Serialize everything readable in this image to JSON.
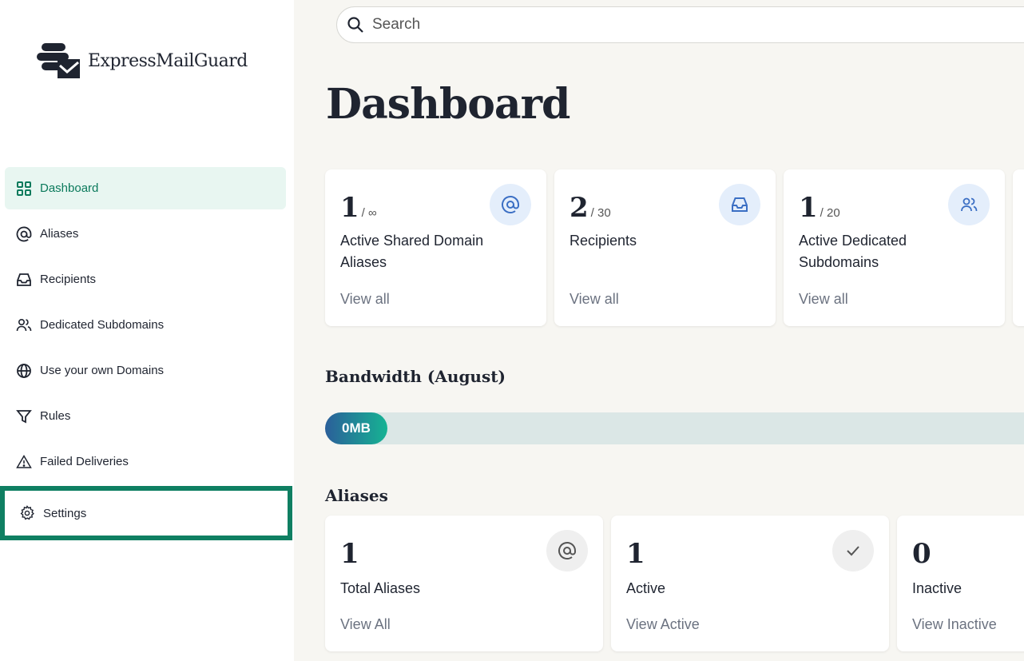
{
  "brand": {
    "name": "ExpressMailGuard"
  },
  "sidebar": {
    "items": [
      {
        "label": "Dashboard",
        "icon": "grid-icon"
      },
      {
        "label": "Aliases",
        "icon": "at-icon"
      },
      {
        "label": "Recipients",
        "icon": "inbox-icon"
      },
      {
        "label": "Dedicated Subdomains",
        "icon": "users-icon"
      },
      {
        "label": "Use your own Domains",
        "icon": "globe-icon"
      },
      {
        "label": "Rules",
        "icon": "filter-icon"
      },
      {
        "label": "Failed Deliveries",
        "icon": "warning-icon"
      },
      {
        "label": "Settings",
        "icon": "gear-icon"
      }
    ]
  },
  "search": {
    "placeholder": "Search"
  },
  "page": {
    "title": "Dashboard"
  },
  "stats": [
    {
      "value": "1",
      "max": "/ ∞",
      "label": "Active Shared Domain Aliases",
      "link": "View all"
    },
    {
      "value": "2",
      "max": "/ 30",
      "label": "Recipients",
      "link": "View all"
    },
    {
      "value": "1",
      "max": "/ 20",
      "label": "Active Dedicated Subdomains",
      "link": "View all"
    }
  ],
  "bandwidth": {
    "title": "Bandwidth (August)",
    "used": "0MB",
    "colors": {
      "start": "#2b5f9a",
      "end": "#16b393"
    }
  },
  "aliases": {
    "title": "Aliases",
    "cards": [
      {
        "value": "1",
        "label": "Total Aliases",
        "link": "View All"
      },
      {
        "value": "1",
        "label": "Active",
        "link": "View Active"
      },
      {
        "value": "0",
        "label": "Inactive",
        "link": "View Inactive"
      }
    ]
  },
  "colors": {
    "accent": "#0b7a5c",
    "highlight_border": "#0f7f62",
    "icon_bg": "#e4eefb"
  }
}
